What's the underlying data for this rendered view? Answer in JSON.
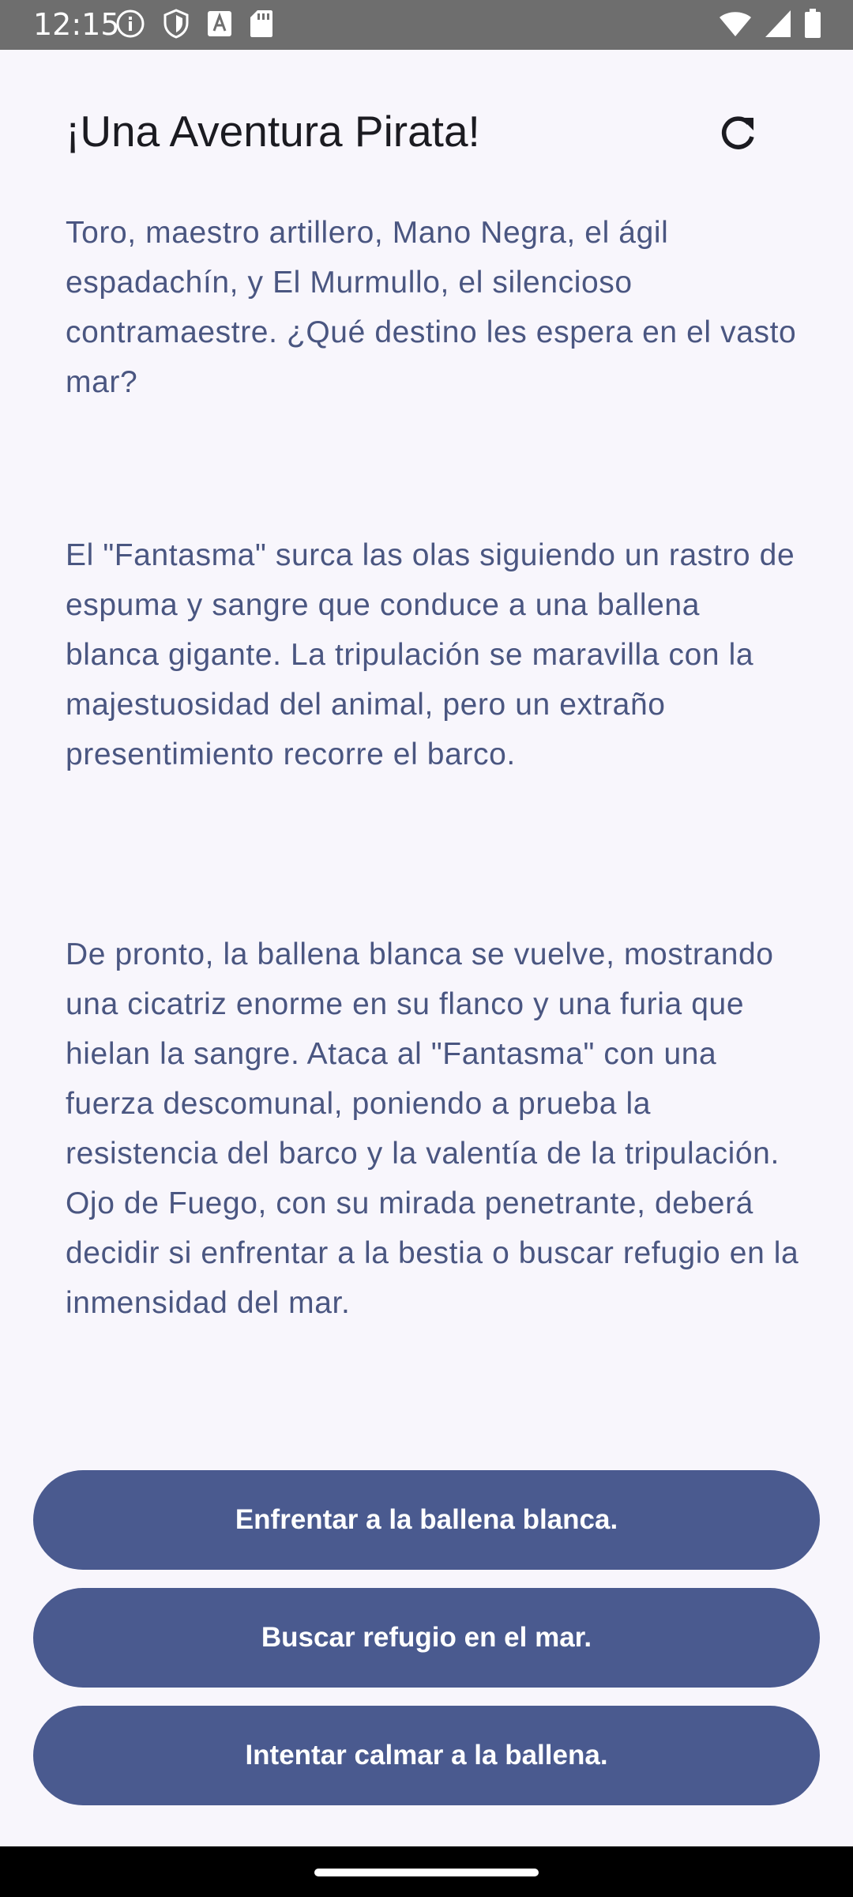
{
  "status_bar": {
    "time": "12:15",
    "left_icons": [
      "info-icon",
      "shield-icon",
      "font-download-icon",
      "sd-card-icon"
    ],
    "right_icons": [
      "wifi-icon",
      "cell-signal-icon",
      "battery-icon"
    ]
  },
  "app_bar": {
    "title": "¡Una Aventura Pirata!",
    "refresh_icon": "refresh-icon"
  },
  "story": {
    "paragraphs": [
      "la Sirenita, la bella y astuta navegante, el fornido Toro, maestro artillero, Mano Negra, el ágil espadachín, y El Murmullo, el silencioso contramaestre.  ¿Qué destino les espera en el vasto mar?",
      "El \"Fantasma\" surca las olas siguiendo un rastro de espuma y sangre que conduce a una ballena blanca gigante. La tripulación se maravilla con la majestuosidad del animal, pero un extraño presentimiento recorre el barco.",
      "De pronto, la ballena blanca se vuelve, mostrando una cicatriz enorme en su flanco y una furia que hielan la sangre. Ataca al \"Fantasma\" con una fuerza descomunal, poniendo a prueba la resistencia del barco y la valentía de la tripulación. Ojo de Fuego, con su mirada penetrante, deberá decidir si enfrentar a la bestia o buscar refugio en la inmensidad del mar."
    ]
  },
  "choices": [
    {
      "label": "Enfrentar a la ballena blanca."
    },
    {
      "label": "Buscar refugio en el mar."
    },
    {
      "label": "Intentar calmar a la ballena."
    }
  ],
  "colors": {
    "background": "#f8f6fc",
    "text": "#4a5681",
    "button": "#4a5a8f",
    "status_bar": "#6e6e6e"
  }
}
